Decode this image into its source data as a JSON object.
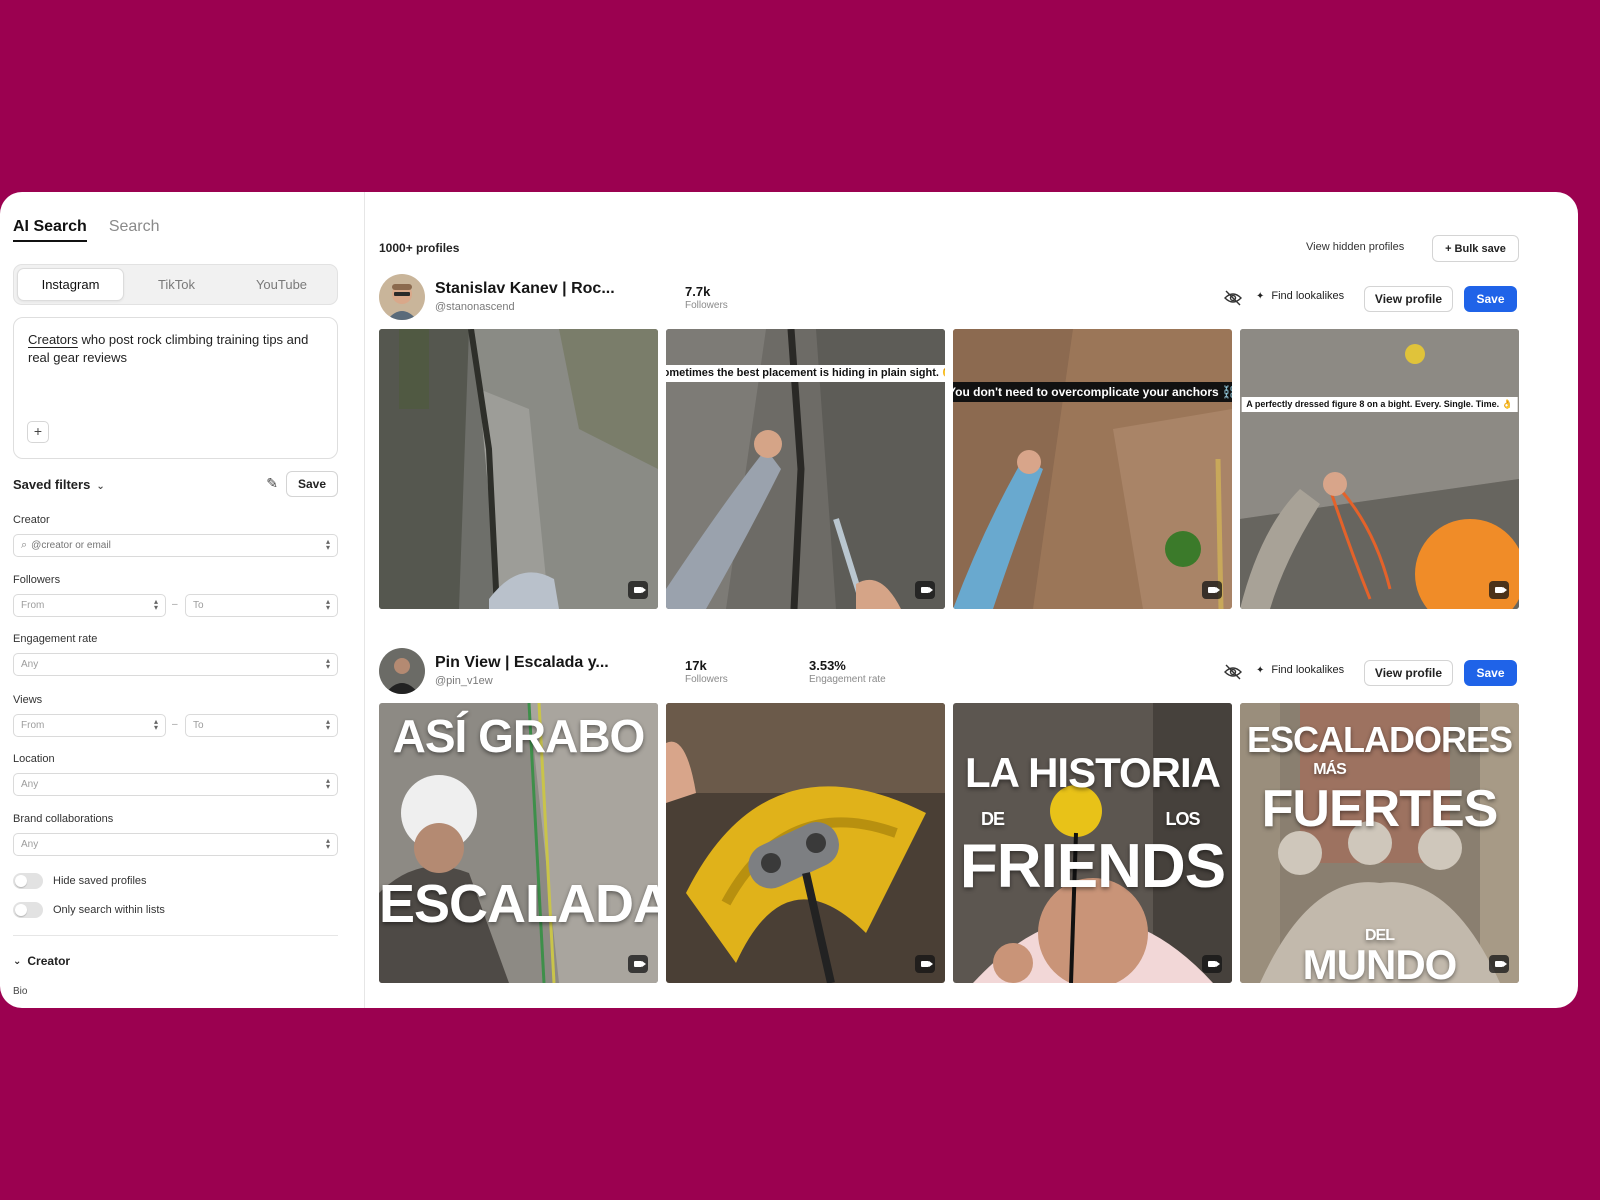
{
  "sidebar": {
    "tabs": [
      "AI Search",
      "Search"
    ],
    "platforms": [
      "Instagram",
      "TikTok",
      "YouTube"
    ],
    "prompt": {
      "highlight": "Creators",
      "rest": " who post rock climbing training tips and real gear reviews",
      "plus": "+"
    },
    "saved_filters": {
      "label": "Saved filters",
      "save": "Save"
    },
    "filters": {
      "creator": {
        "label": "Creator",
        "placeholder": "@creator or email"
      },
      "followers": {
        "label": "Followers",
        "from": "From",
        "to": "To"
      },
      "engagement": {
        "label": "Engagement rate",
        "value": "Any"
      },
      "views": {
        "label": "Views",
        "from": "From",
        "to": "To"
      },
      "location": {
        "label": "Location",
        "value": "Any"
      },
      "brand": {
        "label": "Brand collaborations",
        "value": "Any"
      }
    },
    "toggles": {
      "hide_saved": "Hide saved profiles",
      "only_lists": "Only search within lists"
    },
    "creator_section": "Creator",
    "bio_label": "Bio"
  },
  "main": {
    "count": "1000+ profiles",
    "view_hidden": "View hidden profiles",
    "bulk_save": "+ Bulk save",
    "profiles": [
      {
        "name": "Stanislav Kanev | Roc...",
        "handle": "@stanonascend",
        "followers": "7.7k",
        "followers_label": "Followers",
        "find_lookalikes": "Find lookalikes",
        "view_profile": "View profile",
        "save": "Save",
        "captions": [
          "",
          "Sometimes the best placement is hiding in plain sight. 🧐",
          "You don't need to overcomplicate your anchors ⛓️",
          "A perfectly dressed figure 8 on a bight. Every. Single. Time. 👌"
        ]
      },
      {
        "name": "Pin View | Escalada y...",
        "handle": "@pin_v1ew",
        "followers": "17k",
        "followers_label": "Followers",
        "engagement": "3.53%",
        "engagement_label": "Engagement rate",
        "find_lookalikes": "Find lookalikes",
        "view_profile": "View profile",
        "save": "Save",
        "thumb1": {
          "top": "ASÍ GRABO",
          "bottom": "ESCALADA"
        },
        "thumb3": {
          "line1": "LA HISTORIA",
          "de": "DE",
          "los": "LOS",
          "line3": "FRIENDS"
        },
        "thumb4": {
          "line1": "ESCALADORES",
          "mas": "MÁS",
          "line2": "FUERTES",
          "del": "DEL",
          "line3": "MUNDO"
        }
      }
    ]
  },
  "colors": {
    "background": "#9b0150",
    "primary": "#1f63e8"
  }
}
